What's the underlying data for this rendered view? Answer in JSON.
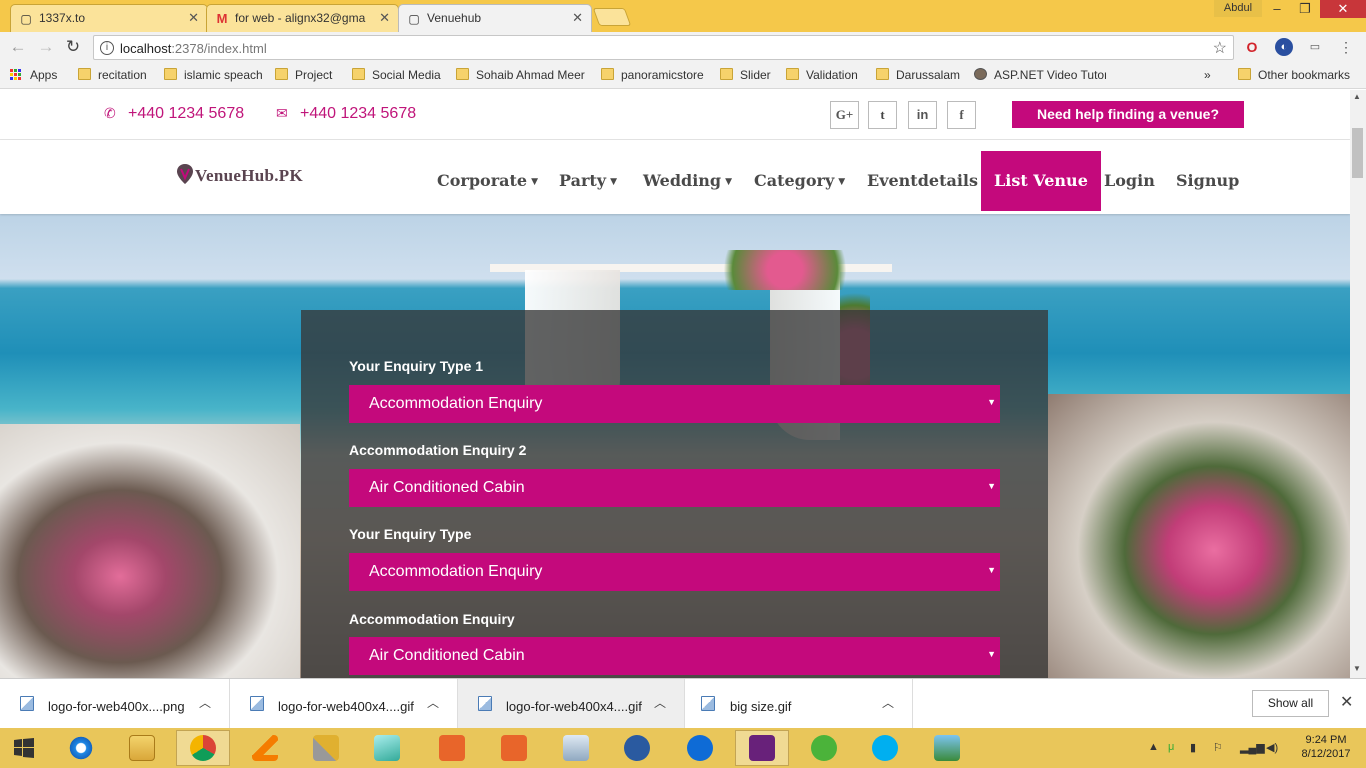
{
  "browser": {
    "tabs": [
      {
        "title": "1337x.to",
        "icon": "page-icon"
      },
      {
        "title": "for web - alignx32@gma",
        "icon": "gmail-icon"
      },
      {
        "title": "Venuehub",
        "icon": "page-icon",
        "active": true
      }
    ],
    "user_label": "Abdul",
    "address": {
      "host": "localhost",
      "path": ":2378/index.html"
    },
    "bookmarks": [
      {
        "label": "Apps",
        "icon": "apps-icon"
      },
      {
        "label": "recitation",
        "icon": "folder-icon"
      },
      {
        "label": "islamic speach",
        "icon": "folder-icon"
      },
      {
        "label": "Project",
        "icon": "folder-icon"
      },
      {
        "label": "Social Media",
        "icon": "folder-icon"
      },
      {
        "label": "Sohaib Ahmad Meer",
        "icon": "folder-icon"
      },
      {
        "label": "panoramicstore",
        "icon": "folder-icon"
      },
      {
        "label": "Slider",
        "icon": "folder-icon"
      },
      {
        "label": "Validation",
        "icon": "folder-icon"
      },
      {
        "label": "Darussalam",
        "icon": "folder-icon"
      },
      {
        "label": "ASP.NET Video Tutori",
        "icon": "avatar-icon"
      }
    ],
    "bookmarks_overflow": "»",
    "other_bookmarks": "Other bookmarks"
  },
  "site": {
    "contacts": [
      {
        "icon": "phone-icon",
        "text": "+440 1234 5678"
      },
      {
        "icon": "envelope-icon",
        "text": "+440 1234 5678"
      }
    ],
    "social": [
      {
        "name": "google-plus-icon",
        "glyph": "G+"
      },
      {
        "name": "twitter-icon",
        "glyph": "t"
      },
      {
        "name": "linkedin-icon",
        "glyph": "in"
      },
      {
        "name": "facebook-icon",
        "glyph": "f"
      }
    ],
    "help_button": "Need help finding a venue?",
    "logo": "VenueHub.PK",
    "nav": [
      {
        "label": "Corporate",
        "dropdown": true
      },
      {
        "label": "Party",
        "dropdown": true
      },
      {
        "label": "Wedding",
        "dropdown": true
      },
      {
        "label": "Category",
        "dropdown": true
      },
      {
        "label": "Eventdetails",
        "dropdown": false
      },
      {
        "label": "List Venue",
        "dropdown": false,
        "active": true
      },
      {
        "label": "Login",
        "dropdown": false
      },
      {
        "label": "Signup",
        "dropdown": false
      }
    ],
    "form": [
      {
        "label": "Your Enquiry Type 1",
        "value": "Accommodation Enquiry"
      },
      {
        "label": "Accommodation Enquiry 2",
        "value": "Air Conditioned Cabin"
      },
      {
        "label": "Your Enquiry Type",
        "value": "Accommodation Enquiry"
      },
      {
        "label": "Accommodation Enquiry",
        "value": "Air Conditioned Cabin"
      }
    ],
    "brand_color": "#c4097c"
  },
  "downloads": {
    "items": [
      {
        "name": "logo-for-web400x....png"
      },
      {
        "name": "logo-for-web400x4....gif"
      },
      {
        "name": "logo-for-web400x4....gif"
      },
      {
        "name": "big size.gif"
      }
    ],
    "show_all": "Show all"
  },
  "taskbar": {
    "time": "9:24 PM",
    "date": "8/12/2017"
  }
}
